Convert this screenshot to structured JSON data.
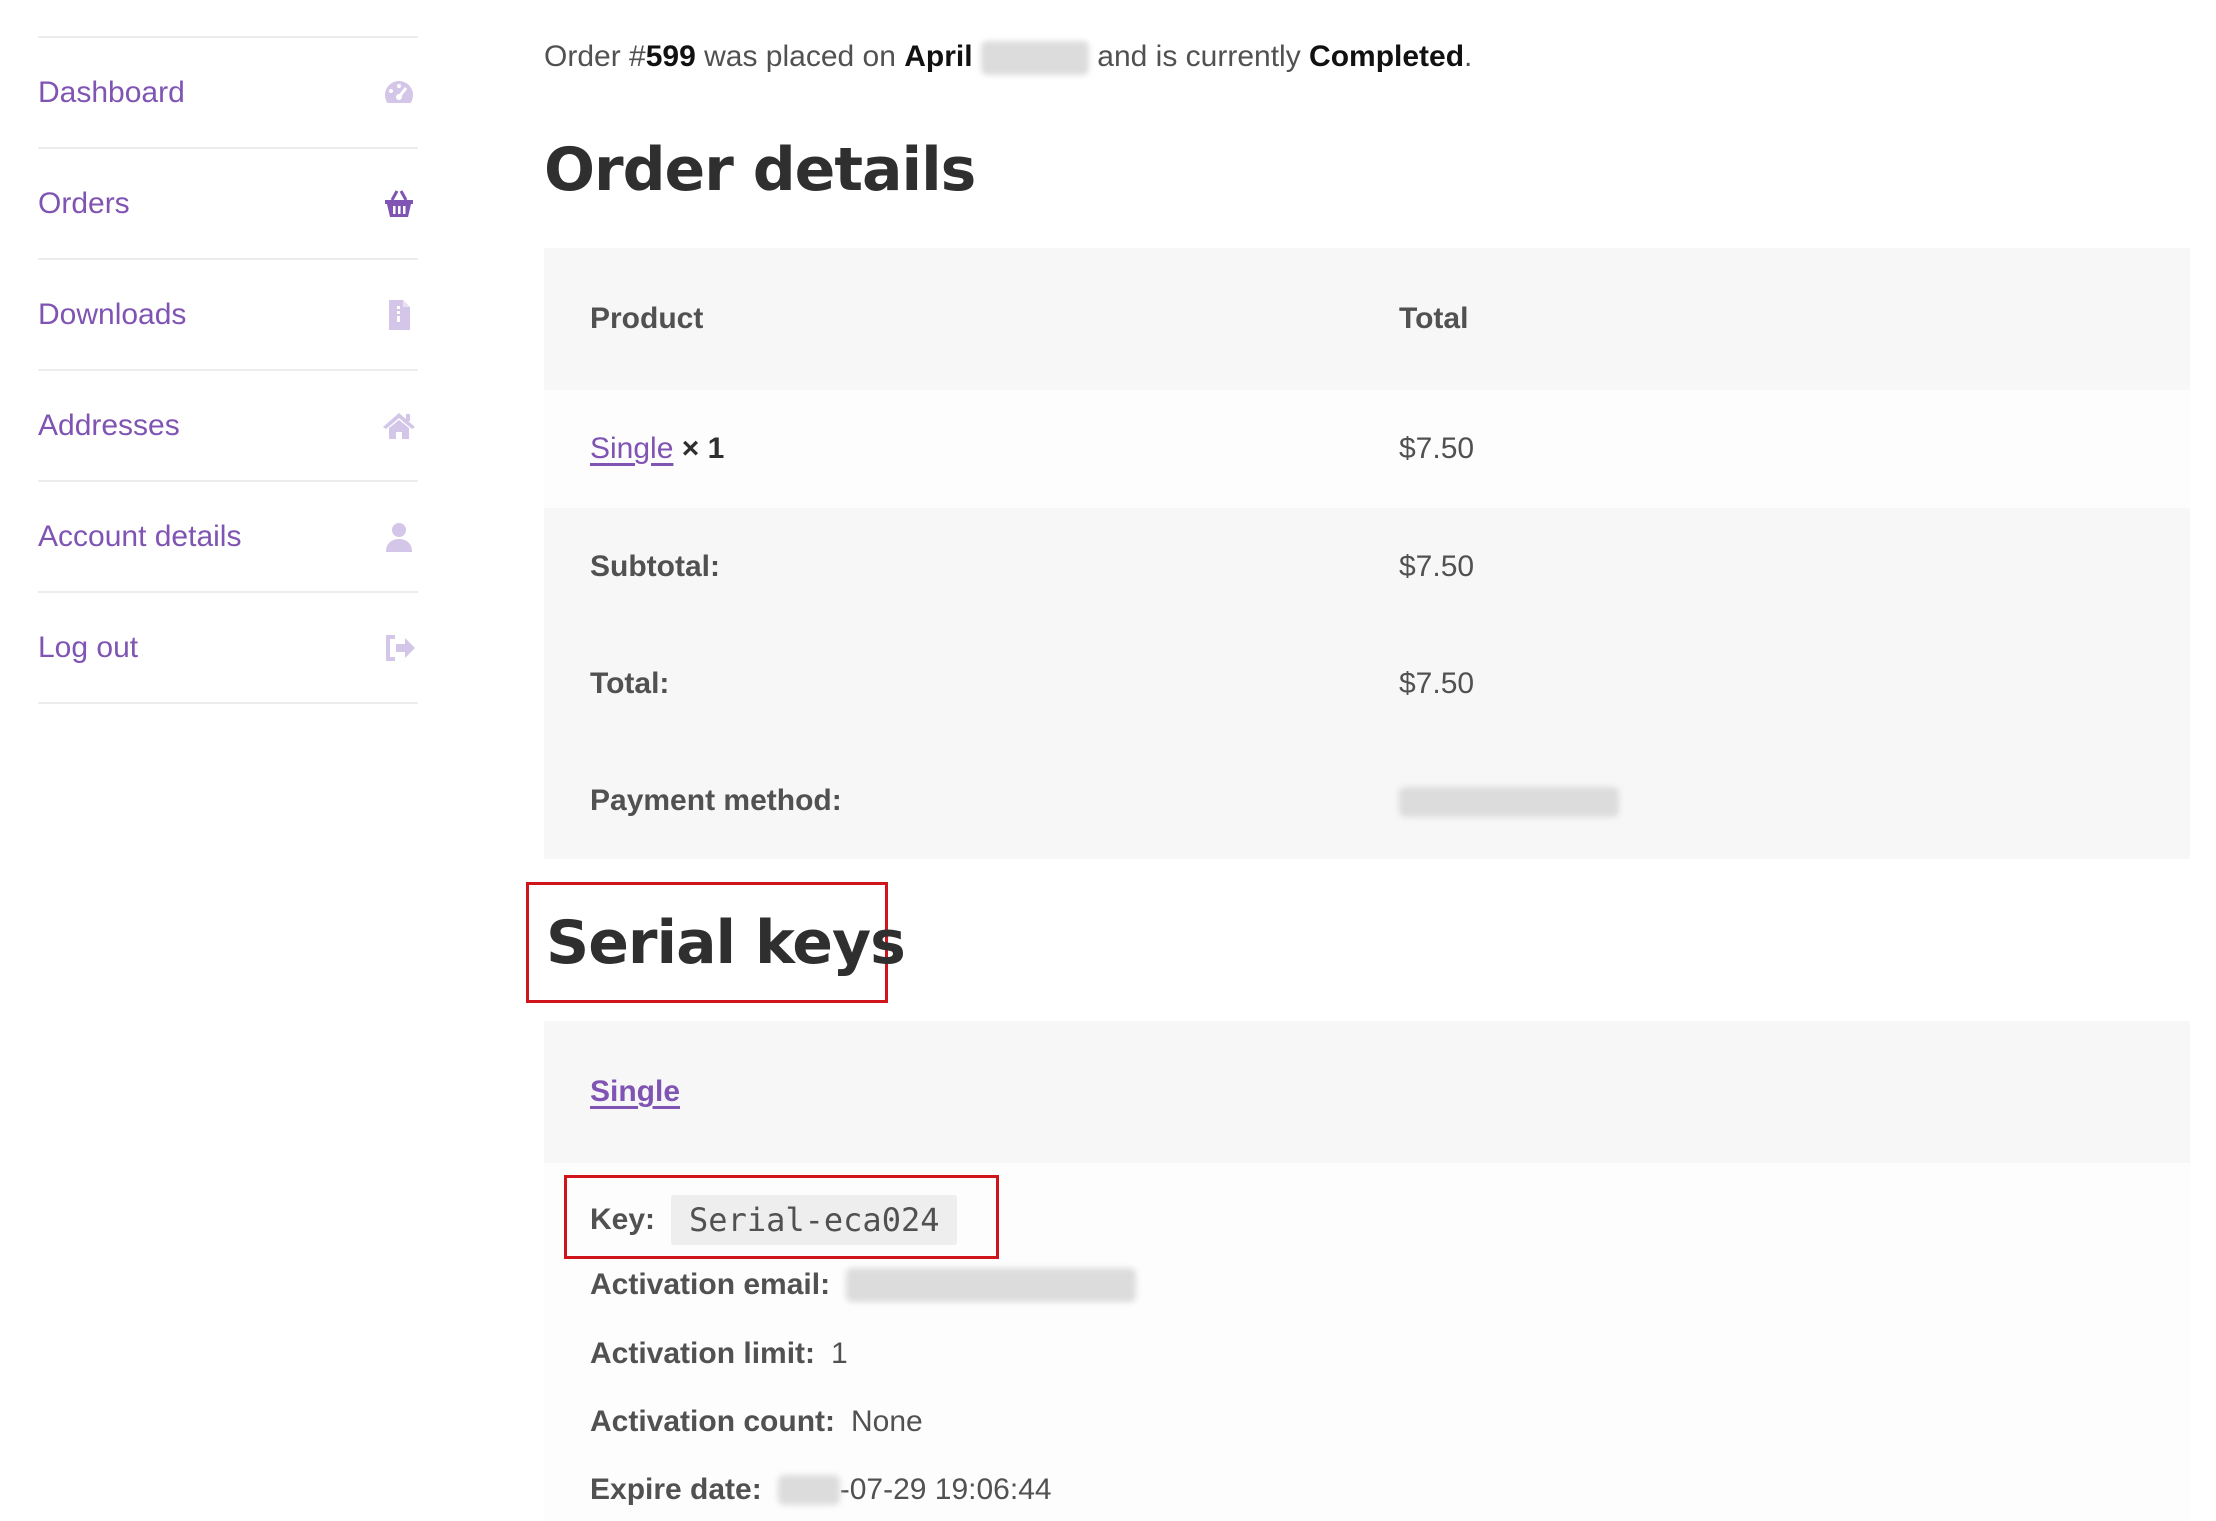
{
  "sidebar": {
    "items": [
      {
        "label": "Dashboard",
        "icon": "dashboard-icon"
      },
      {
        "label": "Orders",
        "icon": "basket-icon"
      },
      {
        "label": "Downloads",
        "icon": "file-download-icon"
      },
      {
        "label": "Addresses",
        "icon": "home-icon"
      },
      {
        "label": "Account details",
        "icon": "user-icon"
      },
      {
        "label": "Log out",
        "icon": "logout-icon"
      }
    ]
  },
  "notice": {
    "prefix": "Order #",
    "order_number": "599",
    "placed_on": " was placed on ",
    "month": "April",
    "status_text": " and is currently ",
    "status": "Completed",
    "suffix": "."
  },
  "order_details": {
    "title": "Order details",
    "columns": [
      "Product",
      "Total"
    ],
    "item": {
      "product": "Single",
      "qty": "× 1",
      "total": "$7.50"
    },
    "rows": [
      {
        "label": "Subtotal:",
        "value": "$7.50"
      },
      {
        "label": "Total:",
        "value": "$7.50"
      },
      {
        "label": "Payment method:",
        "value": ""
      }
    ]
  },
  "serial_keys": {
    "title": "Serial keys",
    "product": "Single",
    "key_label": "Key:",
    "key_value": "Serial-eca024",
    "activation_email_label": "Activation email:",
    "activation_limit_label": "Activation limit:",
    "activation_limit_value": "1",
    "activation_count_label": "Activation count:",
    "activation_count_value": "None",
    "expire_date_label": "Expire date:",
    "expire_date_value": "-07-29 19:06:44"
  },
  "colors": {
    "link": "#7f54b3",
    "highlight": "#d0141c",
    "table_bg": "#f7f7f7"
  }
}
